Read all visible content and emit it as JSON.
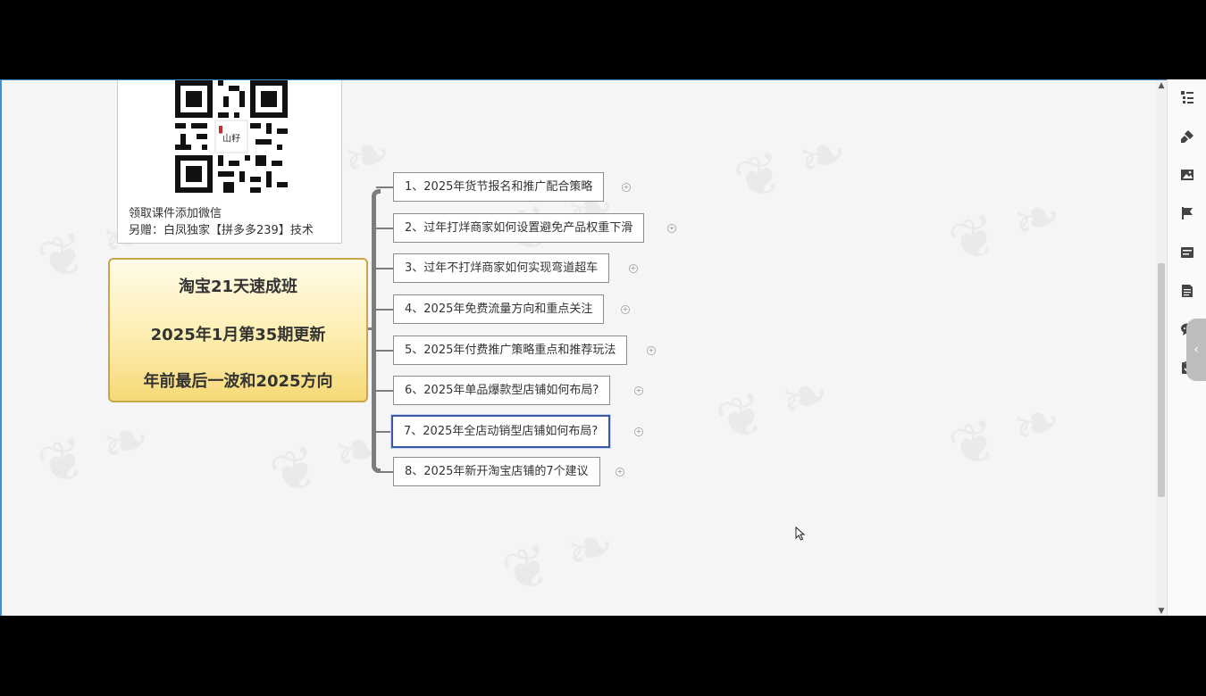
{
  "qr_card": {
    "logo_text": "山籽",
    "line1": "领取课件添加微信",
    "line2": "另赠：白凤独家【拼多多239】技术"
  },
  "central_topic": {
    "lines": [
      "淘宝21天速成班",
      "2025年1月第35期更新",
      "年前最后一波和2025方向"
    ]
  },
  "topics": [
    {
      "label": "1、2025年货节报名和推广配合策略"
    },
    {
      "label": "2、过年打烊商家如何设置避免产品权重下滑"
    },
    {
      "label": "3、过年不打烊商家如何实现弯道超车"
    },
    {
      "label": "4、2025年免费流量方向和重点关注"
    },
    {
      "label": "5、2025年付费推广策略重点和推荐玩法"
    },
    {
      "label": "6、2025年单品爆款型店铺如何布局?"
    },
    {
      "label": "7、2025年全店动销型店铺如何布局?",
      "selected": true
    },
    {
      "label": "8、2025年新开淘宝店铺的7个建议"
    }
  ],
  "side_panel": {
    "icons": [
      "outline-icon",
      "format-brush-icon",
      "image-icon",
      "flag-icon",
      "label-icon",
      "notes-icon",
      "comment-icon",
      "task-icon"
    ]
  },
  "colors": {
    "central_fill": "#fdeeb0",
    "central_border": "#c9a64a",
    "selected_border": "#3a5aa8",
    "canvas_border": "#3d8fd6"
  }
}
